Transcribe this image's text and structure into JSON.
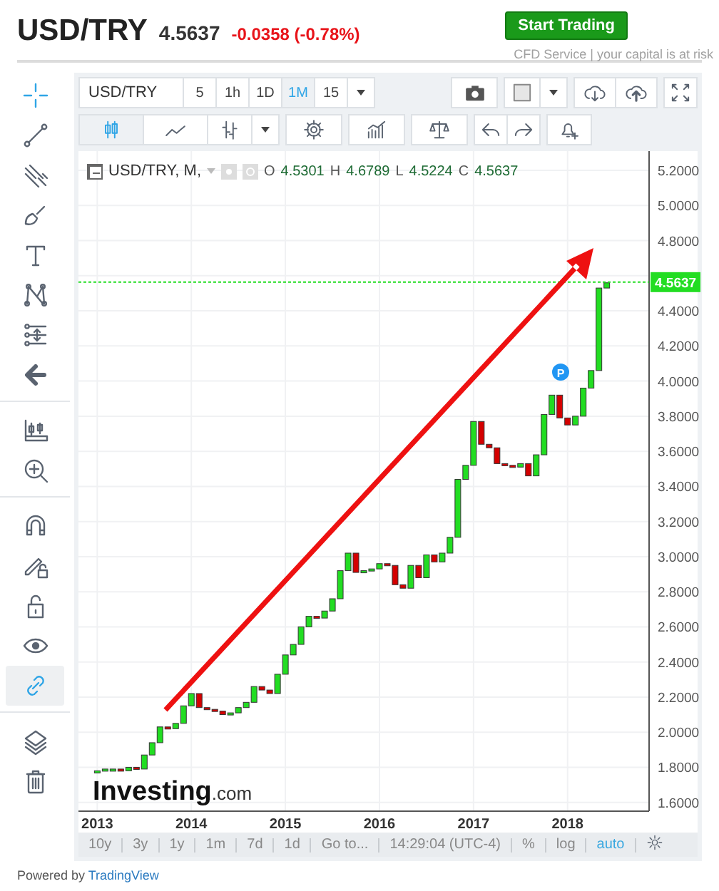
{
  "header": {
    "symbol": "USD/TRY",
    "price": "4.5637",
    "change": "-0.0358 (-0.78%)",
    "cta": "Start Trading",
    "disclaimer": "CFD Service | your capital is at risk"
  },
  "tool_groups": [
    {
      "tools": [
        {
          "kind": "crosshair",
          "selected": true
        },
        {
          "kind": "trend-line",
          "selected": false
        },
        {
          "kind": "pitchfork",
          "selected": false
        },
        {
          "kind": "brush",
          "selected": false
        },
        {
          "kind": "text",
          "selected": false
        },
        {
          "kind": "pattern",
          "selected": false
        },
        {
          "kind": "measure",
          "selected": false
        },
        {
          "kind": "arrow-left",
          "selected": false
        }
      ]
    },
    {
      "tools": [
        {
          "kind": "ruler",
          "selected": false
        },
        {
          "kind": "zoom",
          "selected": false
        }
      ]
    },
    {
      "tools": [
        {
          "kind": "magnet",
          "selected": false
        },
        {
          "kind": "pencil-lock",
          "selected": false
        },
        {
          "kind": "lock",
          "selected": false
        },
        {
          "kind": "eye",
          "selected": false
        },
        {
          "kind": "link",
          "selected": true
        }
      ]
    },
    {
      "tools": [
        {
          "kind": "layers",
          "selected": false
        },
        {
          "kind": "trash",
          "selected": false
        }
      ]
    }
  ],
  "toolbar": {
    "symbol": "USD/TRY",
    "intervals": [
      {
        "label": "5",
        "selected": false
      },
      {
        "label": "1h",
        "selected": false
      },
      {
        "label": "1D",
        "selected": false
      },
      {
        "label": "1M",
        "selected": true
      },
      {
        "label": "15",
        "selected": false
      }
    ],
    "chart_types": [
      {
        "kind": "candles",
        "selected": true
      },
      {
        "kind": "area",
        "selected": false
      },
      {
        "kind": "bars",
        "selected": false
      }
    ]
  },
  "chart": {
    "legend": {
      "title": "USD/TRY, M,",
      "values": [
        {
          "label": "O",
          "value": "4.5301"
        },
        {
          "label": "H",
          "value": "4.6789"
        },
        {
          "label": "L",
          "value": "4.5224"
        },
        {
          "label": "C",
          "value": "4.5637"
        }
      ]
    },
    "last_price": "4.5637",
    "marker": "P",
    "watermark": {
      "brand": "Investing",
      "suffix": ".com"
    },
    "y_axis_labels_upper": [
      "5.2000",
      "5.0000",
      "4.8000"
    ],
    "y_axis_labels_lower": [
      "4.4000",
      "4.2000",
      "4.0000",
      "3.8000",
      "3.6000",
      "3.4000",
      "3.2000",
      "3.0000",
      "2.8000",
      "2.6000",
      "2.4000",
      "2.2000",
      "2.0000",
      "1.8000",
      "1.6000"
    ],
    "x_axis_labels": [
      "2013",
      "2014",
      "2015",
      "2016",
      "2017",
      "2018"
    ]
  },
  "bottom_bar": {
    "ranges": [
      {
        "label": "10y"
      },
      {
        "label": "3y"
      },
      {
        "label": "1y"
      },
      {
        "label": "1m"
      },
      {
        "label": "7d"
      },
      {
        "label": "1d"
      }
    ],
    "goto": "Go to...",
    "time": "14:29:04 (UTC-4)",
    "options": [
      {
        "label": "%",
        "selected": false
      },
      {
        "label": "log",
        "selected": false
      },
      {
        "label": "auto",
        "selected": true
      }
    ]
  },
  "footer": {
    "prefix": "Powered by",
    "link": "TradingView"
  }
}
